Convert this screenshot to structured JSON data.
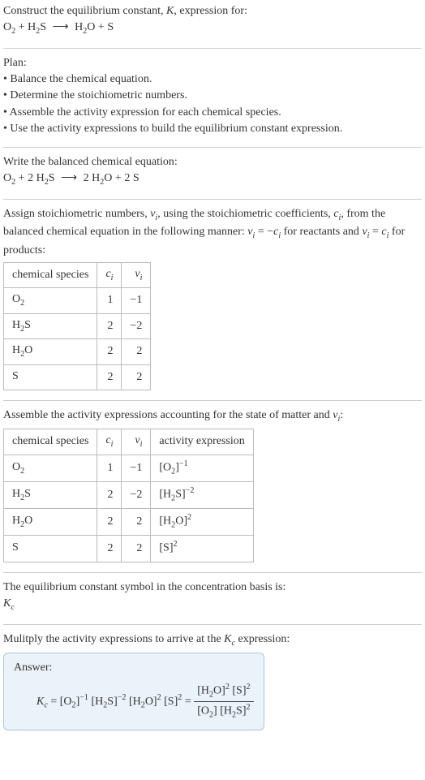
{
  "intro": {
    "line1": "Construct the equilibrium constant, ",
    "k": "K",
    "line1b": ", expression for:",
    "eq_left_o2": "O",
    "eq_left_o2_sub": "2",
    "plus": " + ",
    "eq_left_h2s_h": "H",
    "eq_left_h2s_2": "2",
    "eq_left_h2s_s": "S",
    "arrow": "⟶",
    "eq_right_h2o_h": "H",
    "eq_right_h2o_2": "2",
    "eq_right_h2o_o": "O",
    "eq_right_s": "S"
  },
  "plan": {
    "title": "Plan:",
    "b1": "• Balance the chemical equation.",
    "b2": "• Determine the stoichiometric numbers.",
    "b3": "• Assemble the activity expression for each chemical species.",
    "b4": "• Use the activity expressions to build the equilibrium constant expression."
  },
  "balanced": {
    "title": "Write the balanced chemical equation:",
    "o2_o": "O",
    "o2_2": "2",
    "plus": " + ",
    "two_a": "2 ",
    "h2s_h": "H",
    "h2s_2": "2",
    "h2s_s": "S",
    "arrow": "⟶",
    "two_b": "2 ",
    "h2o_h": "H",
    "h2o_2": "2",
    "h2o_o": "O",
    "two_c": "2 ",
    "s": "S"
  },
  "stoich": {
    "text_a": "Assign stoichiometric numbers, ",
    "nu_i": "ν",
    "i_sub": "i",
    "text_b": ", using the stoichiometric coefficients, ",
    "c_i": "c",
    "text_c": ", from the balanced chemical equation in the following manner: ",
    "eq1a": "ν",
    "eq1b": " = −",
    "eq1c": "c",
    "text_d": " for reactants and ",
    "eq2a": "ν",
    "eq2b": " = ",
    "eq2c": "c",
    "text_e": " for products:"
  },
  "table1": {
    "h1": "chemical species",
    "h2": "c",
    "h2sub": "i",
    "h3": "ν",
    "h3sub": "i",
    "rows": [
      {
        "sp_a": "O",
        "sp_sub": "2",
        "sp_b": "",
        "c": "1",
        "nu": "−1"
      },
      {
        "sp_a": "H",
        "sp_sub": "2",
        "sp_b": "S",
        "c": "2",
        "nu": "−2"
      },
      {
        "sp_a": "H",
        "sp_sub": "2",
        "sp_b": "O",
        "c": "2",
        "nu": "2"
      },
      {
        "sp_a": "S",
        "sp_sub": "",
        "sp_b": "",
        "c": "2",
        "nu": "2"
      }
    ]
  },
  "assemble": {
    "text_a": "Assemble the activity expressions accounting for the state of matter and ",
    "nu": "ν",
    "nu_sub": "i",
    "text_b": ":"
  },
  "table2": {
    "h1": "chemical species",
    "h2": "c",
    "h2sub": "i",
    "h3": "ν",
    "h3sub": "i",
    "h4": "activity expression",
    "rows": [
      {
        "sp_a": "O",
        "sp_sub": "2",
        "sp_b": "",
        "c": "1",
        "nu": "−1",
        "ae_open": "[O",
        "ae_sub": "2",
        "ae_close": "]",
        "ae_exp": "−1"
      },
      {
        "sp_a": "H",
        "sp_sub": "2",
        "sp_b": "S",
        "c": "2",
        "nu": "−2",
        "ae_open": "[H",
        "ae_sub": "2",
        "ae_close": "S]",
        "ae_exp": "−2"
      },
      {
        "sp_a": "H",
        "sp_sub": "2",
        "sp_b": "O",
        "c": "2",
        "nu": "2",
        "ae_open": "[H",
        "ae_sub": "2",
        "ae_close": "O]",
        "ae_exp": "2"
      },
      {
        "sp_a": "S",
        "sp_sub": "",
        "sp_b": "",
        "c": "2",
        "nu": "2",
        "ae_open": "[S]",
        "ae_sub": "",
        "ae_close": "",
        "ae_exp": "2"
      }
    ]
  },
  "symbol": {
    "line": "The equilibrium constant symbol in the concentration basis is:",
    "k": "K",
    "ksub": "c"
  },
  "multiply": {
    "text_a": "Mulitply the activity expressions to arrive at the ",
    "k": "K",
    "ksub": "c",
    "text_b": " expression:"
  },
  "answer": {
    "label": "Answer:",
    "kc_k": "K",
    "kc_c": "c",
    "eq": " = ",
    "t1_open": "[O",
    "t1_sub": "2",
    "t1_close": "]",
    "t1_exp": "−1",
    "sp": " ",
    "t2_open": "[H",
    "t2_sub": "2",
    "t2_close": "S]",
    "t2_exp": "−2",
    "t3_open": "[H",
    "t3_sub": "2",
    "t3_close": "O]",
    "t3_exp": "2",
    "t4_open": "[S]",
    "t4_exp": "2",
    "frac_eq": " = ",
    "num_a_open": "[H",
    "num_a_sub": "2",
    "num_a_close": "O]",
    "num_a_exp": "2",
    "num_b_open": "[S]",
    "num_b_exp": "2",
    "den_a_open": "[O",
    "den_a_sub": "2",
    "den_a_close": "]",
    "den_b_open": "[H",
    "den_b_sub": "2",
    "den_b_close": "S]",
    "den_b_exp": "2"
  }
}
